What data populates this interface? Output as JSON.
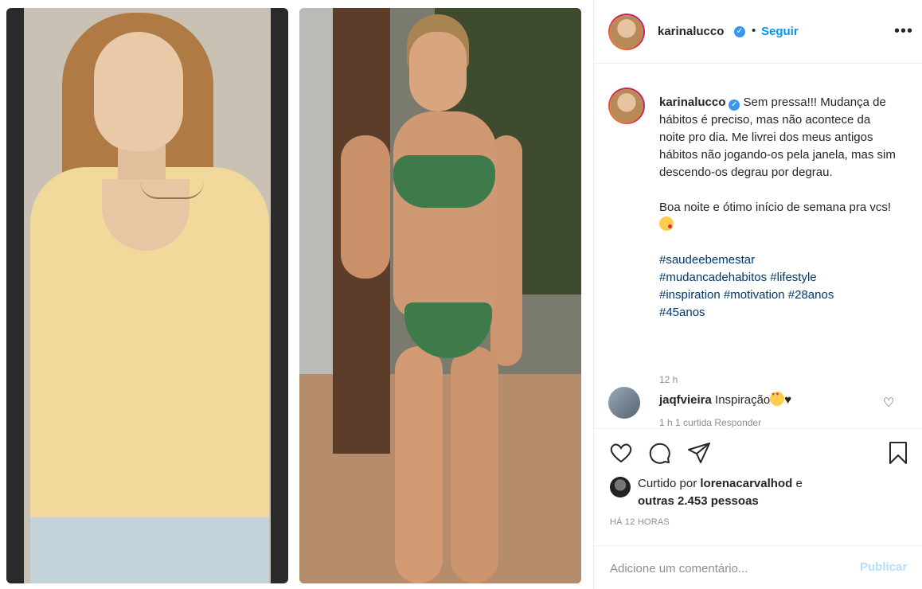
{
  "post": {
    "username": "karinalucco",
    "follow_label": "Seguir",
    "dot": "•",
    "more_label": "•••",
    "verified_mark": "✓"
  },
  "caption": {
    "line1": "Sem pressa!!! Mudança de hábitos é preciso, mas não acontece da noite pro dia. Me livrei dos meus antigos hábitos não jogando-os pela janela, mas sim descendo-os degrau por degrau.",
    "line2": "Boa noite e ótimo início de semana pra vcs!",
    "hashtags": [
      "#saudeebemestar",
      "#mudancadehabitos",
      "#lifestyle",
      "#inspiration",
      "#motivation",
      "#28anos",
      "#45anos"
    ],
    "time": "12 h"
  },
  "comment": {
    "username": "jaqfvieira",
    "text": "Inspiração",
    "heart_suffix": "♥",
    "meta": "1 h   1 curtida   Responder"
  },
  "likes": {
    "prefix": "Curtido por",
    "liker": "lorenacarvalhod",
    "joiner": "e",
    "others": "outras 2.453 pessoas"
  },
  "posted": "HÁ 12 HORAS",
  "add_comment": {
    "placeholder": "Adicione um comentário...",
    "publish_label": "Publicar"
  },
  "colors": {
    "accent": "#0095f6",
    "hashtag": "#00376b",
    "muted": "#8e8e8e",
    "publish_disabled": "#b2dffc"
  },
  "icons": [
    "heart-icon",
    "comment-icon",
    "share-icon",
    "bookmark-icon",
    "more-icon",
    "verified-icon"
  ]
}
